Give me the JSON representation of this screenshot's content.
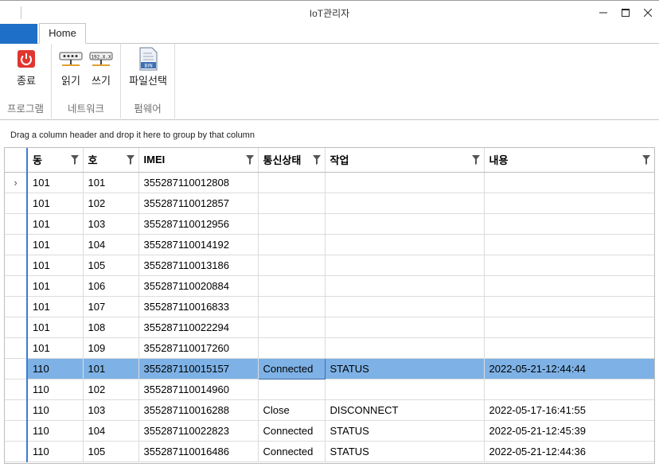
{
  "window": {
    "title": "IoT관리자"
  },
  "ribbon": {
    "tab": "Home",
    "groups": [
      {
        "label": "프로그램",
        "buttons": [
          {
            "label": "종료",
            "icon": "power-icon"
          }
        ]
      },
      {
        "label": "네트워크",
        "buttons": [
          {
            "label": "읽기",
            "icon": "network-read-icon"
          },
          {
            "label": "쓰기",
            "icon": "network-write-icon",
            "icon_text": "192.X.X"
          }
        ]
      },
      {
        "label": "펌웨어",
        "buttons": [
          {
            "label": "파일선택",
            "icon": "bin-file-icon",
            "icon_text": "BIN"
          }
        ]
      }
    ]
  },
  "grid": {
    "group_panel_text": "Drag a column header and drop it here to group by that column",
    "columns": [
      "동",
      "호",
      "IMEI",
      "통신상태",
      "작업",
      "내용"
    ],
    "current_row_indicator": "›",
    "selected_row": 9,
    "rows": [
      [
        "101",
        "101",
        "355287110012808",
        "",
        "",
        ""
      ],
      [
        "101",
        "102",
        "355287110012857",
        "",
        "",
        ""
      ],
      [
        "101",
        "103",
        "355287110012956",
        "",
        "",
        ""
      ],
      [
        "101",
        "104",
        "355287110014192",
        "",
        "",
        ""
      ],
      [
        "101",
        "105",
        "355287110013186",
        "",
        "",
        ""
      ],
      [
        "101",
        "106",
        "355287110020884",
        "",
        "",
        ""
      ],
      [
        "101",
        "107",
        "355287110016833",
        "",
        "",
        ""
      ],
      [
        "101",
        "108",
        "355287110022294",
        "",
        "",
        ""
      ],
      [
        "101",
        "109",
        "355287110017260",
        "",
        "",
        ""
      ],
      [
        "110",
        "101",
        "355287110015157",
        "Connected",
        "STATUS",
        "2022-05-21-12:44:44"
      ],
      [
        "110",
        "102",
        "355287110014960",
        "",
        "",
        ""
      ],
      [
        "110",
        "103",
        "355287110016288",
        "Close",
        "DISCONNECT",
        "2022-05-17-16:41:55"
      ],
      [
        "110",
        "104",
        "355287110022823",
        "Connected",
        "STATUS",
        "2022-05-21-12:45:39"
      ],
      [
        "110",
        "105",
        "355287110016486",
        "Connected",
        "STATUS",
        "2022-05-21-12:44:36"
      ]
    ]
  },
  "colors": {
    "file_tab": "#1e6fc7",
    "selection": "#7eb2e6",
    "indicator_line": "#3c7bd5",
    "power_red": "#e0362f"
  }
}
